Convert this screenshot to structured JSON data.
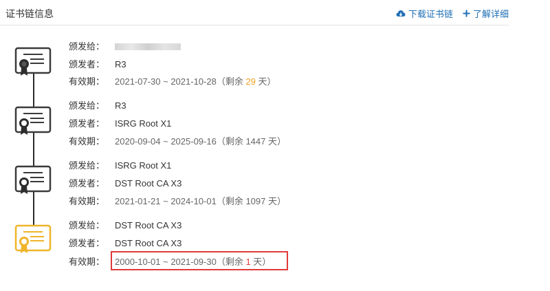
{
  "header": {
    "title": "证书链信息",
    "download_label": "下载证书链",
    "learn_more_label": "了解详细"
  },
  "labels": {
    "issued_to": "颁发给：",
    "issuer": "颁发者：",
    "validity": "有效期："
  },
  "certs": [
    {
      "issued_to": "",
      "issuer": "R3",
      "range": "2021-07-30 ~ 2021-10-28",
      "remain_prefix": "（剩余 ",
      "remain_days": "29",
      "remain_suffix": " 天）",
      "icon": "certificate-icon"
    },
    {
      "issued_to": "R3",
      "issuer": "ISRG Root X1",
      "range": "2020-09-04 ~ 2025-09-16",
      "remain_prefix": "（剩余 ",
      "remain_days": "1447",
      "remain_suffix": " 天）",
      "icon": "ca-certificate-icon"
    },
    {
      "issued_to": "ISRG Root X1",
      "issuer": "DST Root CA X3",
      "range": "2021-01-21 ~ 2024-10-01",
      "remain_prefix": "（剩余 ",
      "remain_days": "1097",
      "remain_suffix": " 天）",
      "icon": "ca-certificate-icon"
    },
    {
      "issued_to": "DST Root CA X3",
      "issuer": "DST Root CA X3",
      "range": "2000-10-01 ~ 2021-09-30",
      "remain_prefix": "（剩余 ",
      "remain_days": "1",
      "remain_suffix": " 天）",
      "icon": "root-certificate-icon"
    }
  ],
  "colors": {
    "accent": "#1f6fb5",
    "warning_days": "#f0a020",
    "expired_days": "#e53935",
    "root_cert": "#f0b429",
    "highlight_border": "#e03a3a"
  }
}
